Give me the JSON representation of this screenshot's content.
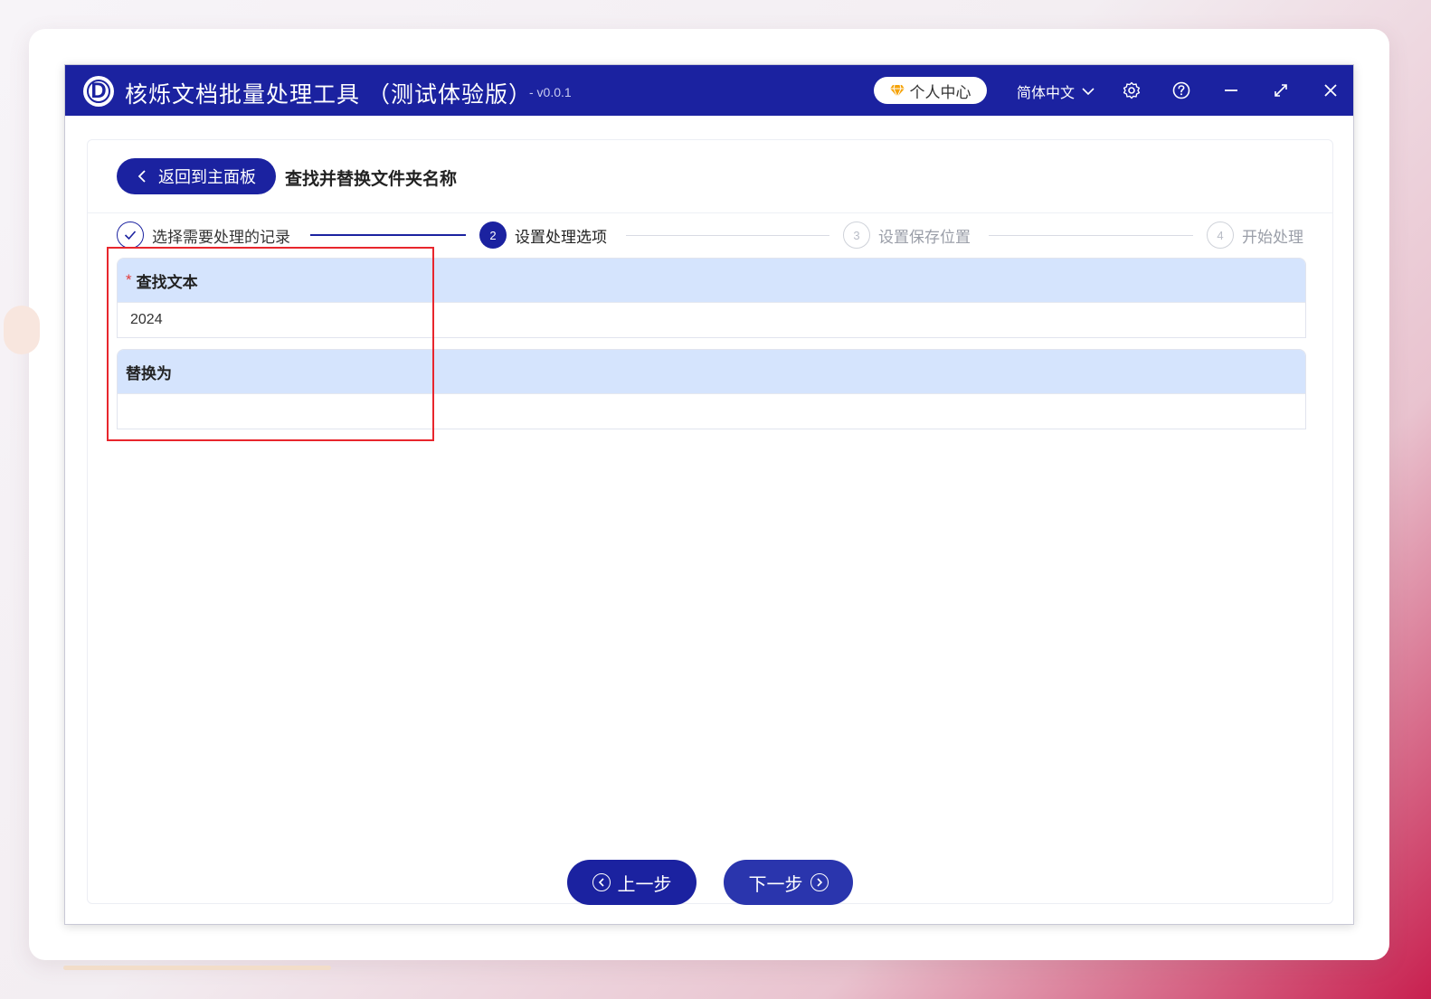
{
  "titlebar": {
    "app_title": "核烁文档批量处理工具 （测试体验版）",
    "version": "- v0.0.1",
    "user_center_label": "个人中心",
    "language_label": "简体中文"
  },
  "toolbar": {
    "back_label": "返回到主面板",
    "page_title": "查找并替换文件夹名称"
  },
  "steps": [
    {
      "number": "1",
      "label": "选择需要处理的记录",
      "state": "done"
    },
    {
      "number": "2",
      "label": "设置处理选项",
      "state": "active"
    },
    {
      "number": "3",
      "label": "设置保存位置",
      "state": "todo"
    },
    {
      "number": "4",
      "label": "开始处理",
      "state": "todo"
    }
  ],
  "form": {
    "find": {
      "label": "查找文本",
      "required_mark": "*",
      "value": "2024"
    },
    "replace": {
      "label": "替换为",
      "value": ""
    }
  },
  "navigation": {
    "prev_label": "上一步",
    "next_label": "下一步"
  },
  "colors": {
    "primary": "#1b22a0",
    "field_header": "#d5e4fd",
    "highlight": "#e8262d"
  }
}
